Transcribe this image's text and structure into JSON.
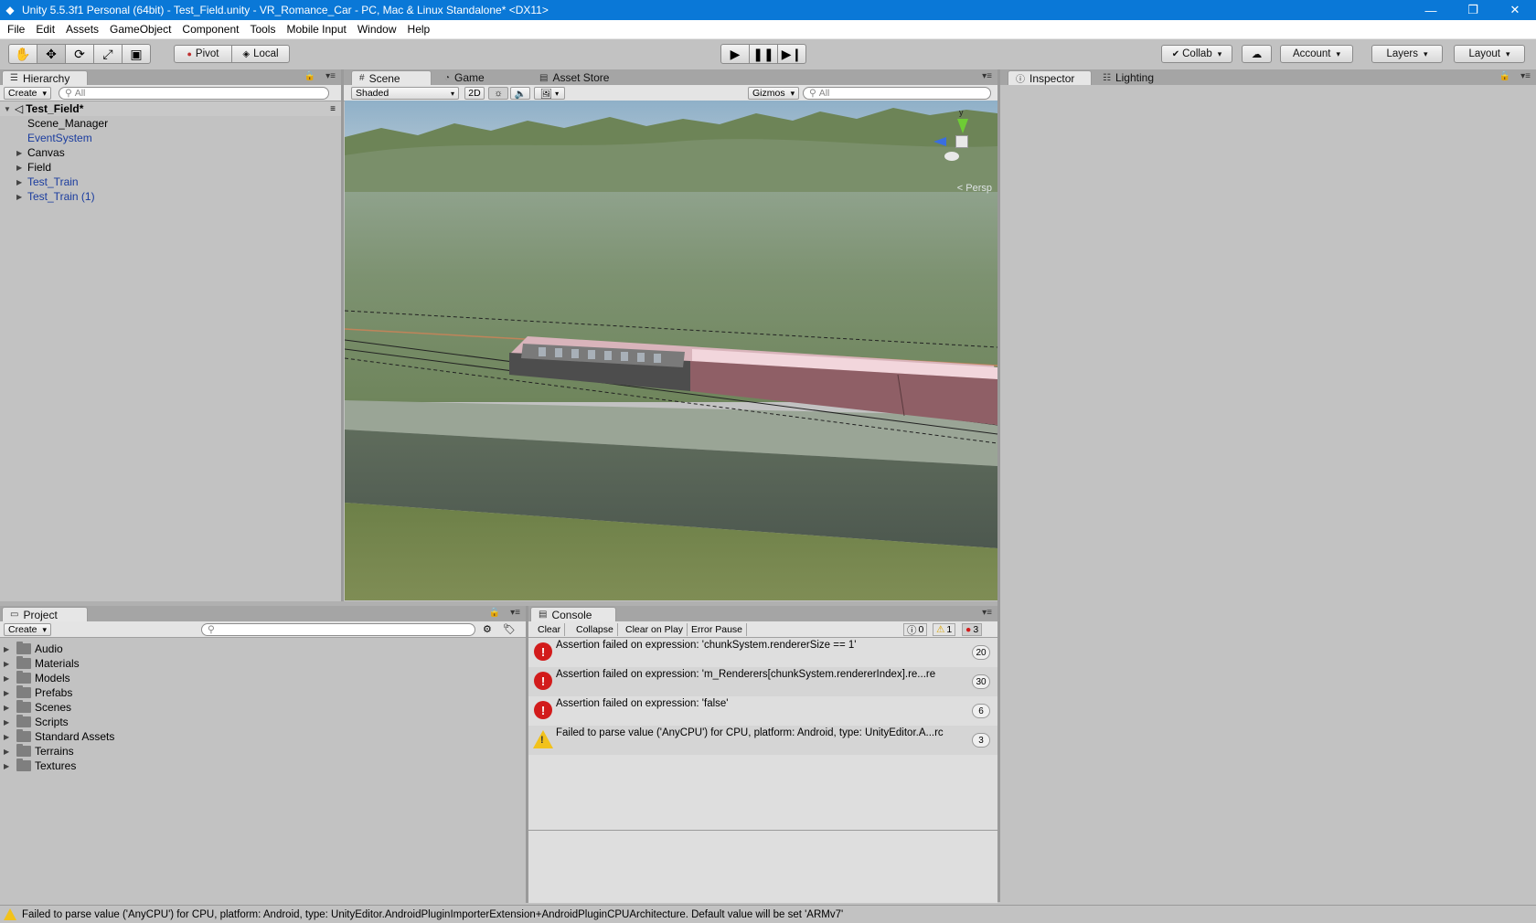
{
  "window": {
    "title": "Unity 5.5.3f1 Personal (64bit) - Test_Field.unity - VR_Romance_Car - PC, Mac & Linux Standalone* <DX11>",
    "controls": [
      "minimize-icon",
      "restore-icon",
      "close-icon"
    ]
  },
  "menu": [
    "File",
    "Edit",
    "Assets",
    "GameObject",
    "Component",
    "Tools",
    "Mobile Input",
    "Window",
    "Help"
  ],
  "toolbar": {
    "pivot_label": "Pivot",
    "local_label": "Local",
    "collab_label": "Collab",
    "account_label": "Account",
    "layers_label": "Layers",
    "layout_label": "Layout"
  },
  "hierarchy": {
    "tab": "Hierarchy",
    "create_label": "Create",
    "search_placeholder": "All",
    "scene_name": "Test_Field*",
    "items": [
      {
        "label": "Scene_Manager",
        "expandable": false,
        "prefab": false
      },
      {
        "label": "EventSystem",
        "expandable": false,
        "prefab": true
      },
      {
        "label": "Canvas",
        "expandable": true,
        "prefab": false
      },
      {
        "label": "Field",
        "expandable": true,
        "prefab": false
      },
      {
        "label": "Test_Train",
        "expandable": true,
        "prefab": true
      },
      {
        "label": "Test_Train (1)",
        "expandable": true,
        "prefab": true
      }
    ]
  },
  "scene": {
    "tabs": [
      "Scene",
      "Game",
      "Asset Store"
    ],
    "shading": "Shaded",
    "mode_2d": "2D",
    "gizmos_label": "Gizmos",
    "search_placeholder": "All",
    "persp_label": "< Persp",
    "gizmo_axis": "y"
  },
  "inspector": {
    "tabs": [
      "Inspector",
      "Lighting"
    ]
  },
  "project": {
    "tab": "Project",
    "create_label": "Create",
    "folders": [
      "Audio",
      "Materials",
      "Models",
      "Prefabs",
      "Scenes",
      "Scripts",
      "Standard Assets",
      "Terrains",
      "Textures"
    ]
  },
  "console": {
    "tab": "Console",
    "buttons": [
      "Clear",
      "Collapse",
      "Clear on Play",
      "Error Pause"
    ],
    "counts": {
      "info": "0",
      "warning": "1",
      "error": "3"
    },
    "entries": [
      {
        "type": "error",
        "message": "Assertion failed on expression: 'chunkSystem.rendererSize == 1'",
        "count": "20"
      },
      {
        "type": "error",
        "message": "Assertion failed on expression: 'm_Renderers[chunkSystem.rendererIndex].re...re",
        "count": "30"
      },
      {
        "type": "error",
        "message": "Assertion failed on expression: 'false'",
        "count": "6"
      },
      {
        "type": "warning",
        "message": "Failed to parse value ('AnyCPU') for CPU, platform: Android, type: UnityEditor.A...rc",
        "count": "3"
      }
    ]
  },
  "status": {
    "message": "Failed to parse value ('AnyCPU') for CPU, platform: Android, type: UnityEditor.AndroidPluginImporterExtension+AndroidPluginCPUArchitecture. Default value will be set 'ARMv7'"
  },
  "colors": {
    "titlebar": "#0a78d7",
    "panel_bg": "#c2c2c2",
    "error": "#d21b1b",
    "warning": "#f2c21b",
    "prefab_blue": "#1a3c9f"
  }
}
